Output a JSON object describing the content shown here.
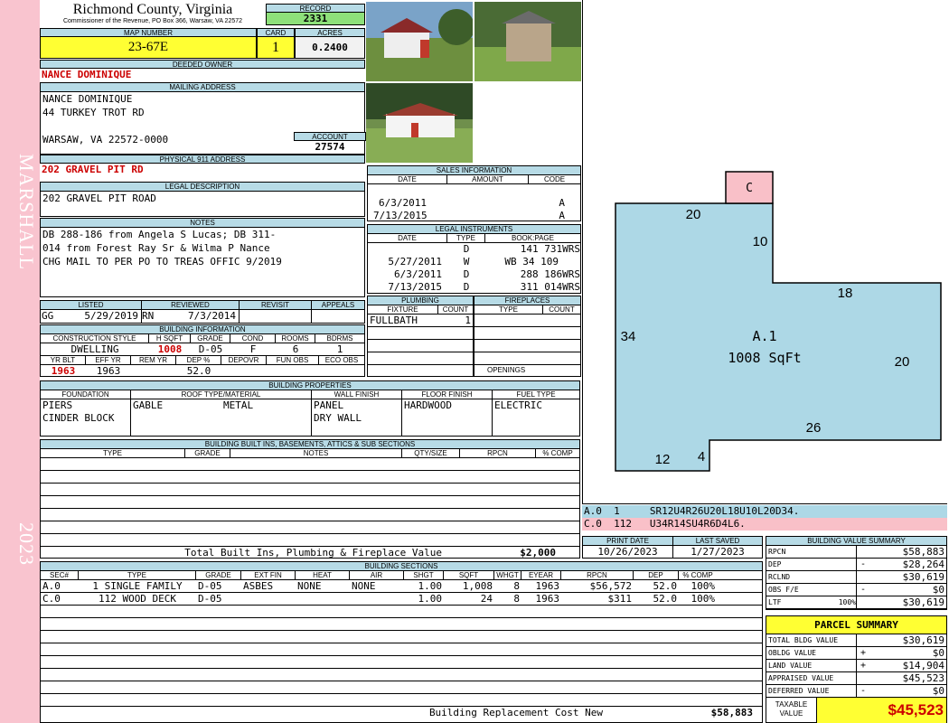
{
  "side": {
    "name": "MARSHALL",
    "year": "2023"
  },
  "header": {
    "county": "Richmond County, Virginia",
    "commissioner": "Commissioner of the Revenue, PO Box 366, Warsaw, VA 22572",
    "record_label": "RECORD",
    "record": "2331",
    "map_label": "MAP NUMBER",
    "map_number": "23-67E",
    "card_label": "CARD",
    "card": "1",
    "acres_label": "ACRES",
    "acres": "0.2400"
  },
  "owner": {
    "deeded_label": "DEEDED OWNER",
    "deeded_owner": "NANCE DOMINIQUE",
    "mailing_label": "MAILING ADDRESS",
    "mailing": [
      "NANCE DOMINIQUE",
      "44 TURKEY TROT RD",
      "",
      "WARSAW, VA 22572-0000"
    ],
    "account_label": "ACCOUNT",
    "account": "27574",
    "physical_label": "PHYSICAL 911 ADDRESS",
    "physical": "202 GRAVEL PIT RD",
    "legal_label": "LEGAL DESCRIPTION",
    "legal": "202 GRAVEL PIT ROAD",
    "notes_label": "NOTES",
    "notes": [
      "DB 288-186 from Angela S Lucas; DB 311-",
      "014 from Forest Ray Sr & Wilma P Nance",
      "CHG MAIL TO PER PO TO TREAS OFFIC 9/2019"
    ]
  },
  "listed": {
    "labels": [
      "LISTED",
      "REVIEWED",
      "REVISIT",
      "APPEALS"
    ],
    "listed_by": "GG",
    "listed_date": "5/29/2019",
    "reviewed_by": "RN",
    "reviewed_date": "7/3/2014"
  },
  "building_info": {
    "title": "BUILDING INFORMATION",
    "labels1": [
      "CONSTRUCTION STYLE",
      "H SQFT",
      "GRADE",
      "COND",
      "ROOMS",
      "BDRMS"
    ],
    "values1": [
      "DWELLING",
      "1008",
      "D-05",
      "F",
      "6",
      "1"
    ],
    "labels2": [
      "YR BLT",
      "EFF YR",
      "REM YR",
      "DEP %",
      "DEPOVR",
      "FUN OBS",
      "ECO OBS"
    ],
    "values2": [
      "1963",
      "1963",
      "",
      "52.0",
      "",
      "",
      ""
    ]
  },
  "sales": {
    "title": "SALES INFORMATION",
    "cols": [
      "DATE",
      "AMOUNT",
      "CODE"
    ],
    "rows": [
      [
        "",
        "",
        ""
      ],
      [
        "6/3/2011",
        "",
        "A"
      ],
      [
        "7/13/2015",
        "",
        "A"
      ]
    ]
  },
  "legal_instruments": {
    "title": "LEGAL INSTRUMENTS",
    "cols": [
      "DATE",
      "TYPE",
      "BOOK:PAGE"
    ],
    "rows": [
      [
        "",
        "D",
        "141 731WRS"
      ],
      [
        "5/27/2011",
        "W",
        "WB 34 109"
      ],
      [
        "6/3/2011",
        "D",
        "288 186WRS"
      ],
      [
        "7/13/2015",
        "D",
        "311 014WRS"
      ]
    ]
  },
  "plumbing": {
    "title": "PLUMBING",
    "cols": [
      "FIXTURE",
      "COUNT"
    ],
    "rows": [
      [
        "FULLBATH",
        "1"
      ]
    ]
  },
  "fireplaces": {
    "title": "FIREPLACES",
    "cols": [
      "TYPE",
      "COUNT"
    ],
    "openings_label": "OPENINGS"
  },
  "properties": {
    "title": "BUILDING PROPERTIES",
    "cols": [
      "FOUNDATION",
      "ROOF TYPE/MATERIAL",
      "WALL FINISH",
      "FLOOR FINISH",
      "FUEL TYPE"
    ],
    "foundation": [
      "PIERS",
      "CINDER BLOCK"
    ],
    "roof_type": "GABLE",
    "roof_material": "METAL",
    "wall": [
      "PANEL",
      "DRY WALL"
    ],
    "floor": "HARDWOOD",
    "fuel": "ELECTRIC"
  },
  "builtins": {
    "title": "BUILDING BUILT INS, BASEMENTS, ATTICS & SUB SECTIONS",
    "cols": [
      "TYPE",
      "GRADE",
      "NOTES",
      "QTY/SIZE",
      "RPCN",
      "% COMP"
    ],
    "total_label": "Total Built Ins, Plumbing & Fireplace Value",
    "total": "$2,000"
  },
  "dates": {
    "print_label": "PRINT DATE",
    "print": "10/26/2023",
    "saved_label": "LAST SAVED",
    "saved": "1/27/2023"
  },
  "sketch": {
    "area_label": "A.1",
    "area_sqft": "1008 SqFt",
    "deck_label": "C",
    "dims": [
      "20",
      "10",
      "18",
      "34",
      "20",
      "26",
      "12",
      "4"
    ],
    "line1": "A.0  1     SR12U4R26U20L18U10L20D34.",
    "line2": "C.0  112   U34R14SU4R6D4L6."
  },
  "sections": {
    "title": "BUILDING SECTIONS",
    "cols": [
      "SEC#",
      "TYPE",
      "GRADE",
      "EXT FIN",
      "HEAT",
      "AIR",
      "SHGT",
      "SQFT",
      "WHGT",
      "EYEAR",
      "RPCN",
      "DEP",
      "% COMP"
    ],
    "rows": [
      [
        "A.0",
        "1 SINGLE FAMILY",
        "D-05",
        "ASBES",
        "NONE",
        "NONE",
        "1.00",
        "1,008",
        "8",
        "1963",
        "$56,572",
        "52.0",
        "100%"
      ],
      [
        "C.0",
        "112 WOOD DECK",
        "D-05",
        "",
        "",
        "",
        "1.00",
        "24",
        "8",
        "1963",
        "$311",
        "52.0",
        "100%"
      ]
    ],
    "replacement_label": "Building Replacement Cost New",
    "replacement": "$58,883"
  },
  "value_summary": {
    "title": "BUILDING VALUE SUMMARY",
    "rows": [
      {
        "k": "RPCN",
        "s": "",
        "v": "$58,883"
      },
      {
        "k": "DEP",
        "s": "-",
        "v": "$28,264"
      },
      {
        "k": "RCLND",
        "s": "",
        "v": "$30,619"
      },
      {
        "k": "OBS F/E",
        "s": "-",
        "v": "$0"
      },
      {
        "k": "LTF",
        "pct": "100%",
        "s": "",
        "v": "$30,619"
      }
    ]
  },
  "parcel": {
    "title": "PARCEL SUMMARY",
    "rows": [
      {
        "k": "TOTAL BLDG VALUE",
        "s": "",
        "v": "$30,619"
      },
      {
        "k": "OBLDG VALUE",
        "s": "+",
        "v": "$0"
      },
      {
        "k": "LAND VALUE",
        "s": "+",
        "v": "$14,904"
      },
      {
        "k": "APPRAISED VALUE",
        "s": "",
        "v": "$45,523"
      },
      {
        "k": "DEFERRED VALUE",
        "s": "-",
        "v": "$0"
      }
    ],
    "taxable_label": "TAXABLE VALUE",
    "taxable": "$45,523"
  }
}
